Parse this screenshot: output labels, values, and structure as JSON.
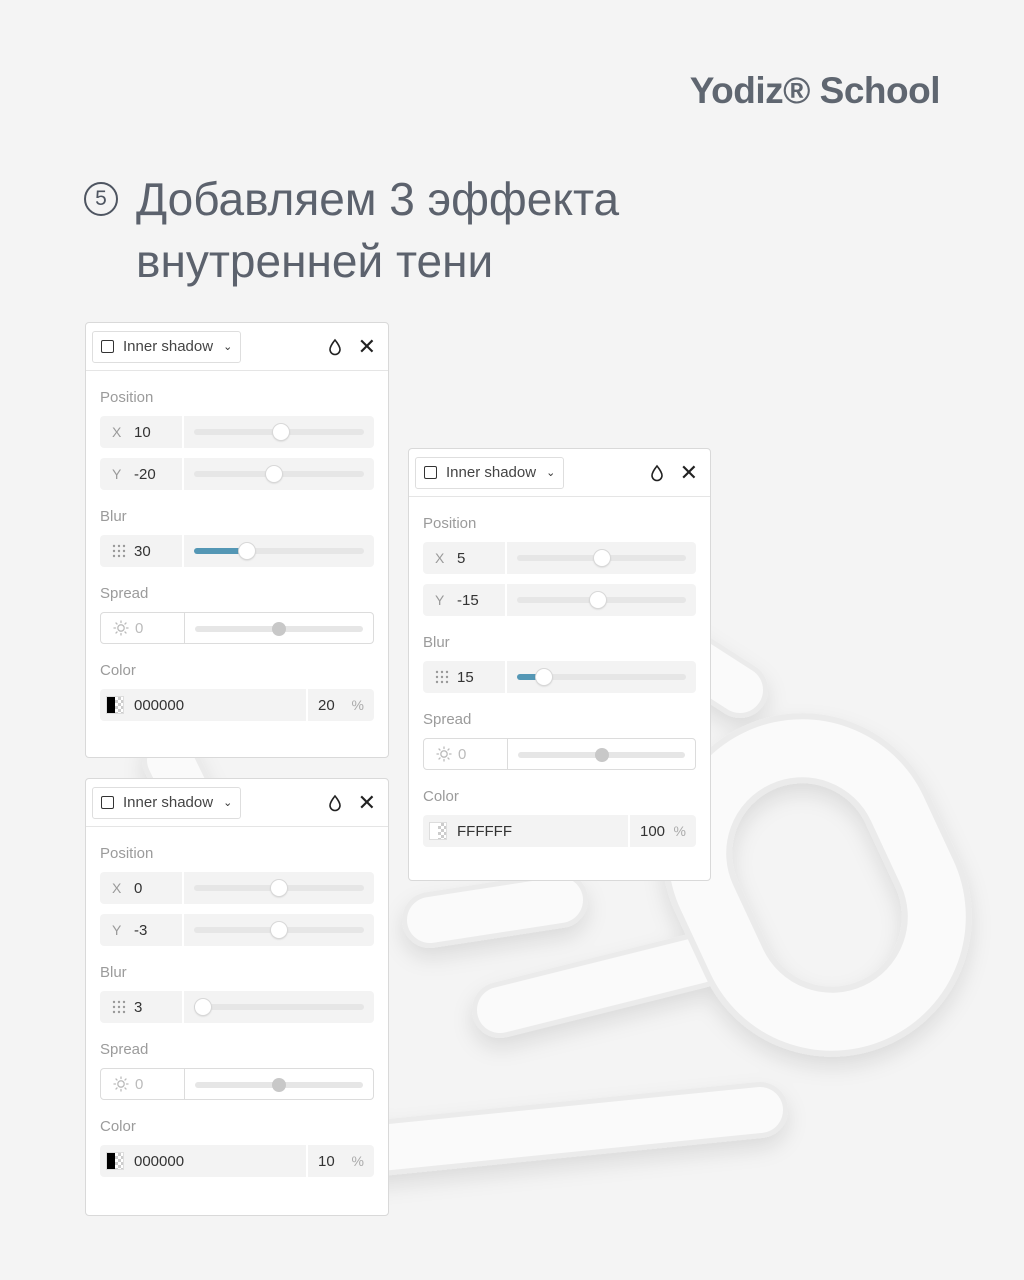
{
  "brand": "Yodiz® School",
  "step_number": "5",
  "title_lines": [
    "Добавляем 3 эффекта",
    "внутренней тени"
  ],
  "colors": {
    "accent": "#5497b5",
    "text": "#5c626d"
  },
  "labels": {
    "effect_type": "Inner shadow",
    "position": "Position",
    "blur": "Blur",
    "spread": "Spread",
    "color": "Color",
    "x": "X",
    "y": "Y",
    "percent": "%"
  },
  "panels": [
    {
      "x": "10",
      "y": "-20",
      "blur": "30",
      "spread": "0",
      "color": "000000",
      "opacity": "20",
      "x_level": 0.51,
      "y_level": 0.47,
      "blur_level": 0.31,
      "spread_level": 0.5,
      "swatch": "#000000"
    },
    {
      "x": "5",
      "y": "-15",
      "blur": "15",
      "spread": "0",
      "color": "FFFFFF",
      "opacity": "100",
      "x_level": 0.5,
      "y_level": 0.48,
      "blur_level": 0.16,
      "spread_level": 0.5,
      "swatch": "#ffffff"
    },
    {
      "x": "0",
      "y": "-3",
      "blur": "3",
      "spread": "0",
      "color": "000000",
      "opacity": "10",
      "x_level": 0.5,
      "y_level": 0.5,
      "blur_level": 0.05,
      "spread_level": 0.5,
      "swatch": "#000000"
    }
  ]
}
